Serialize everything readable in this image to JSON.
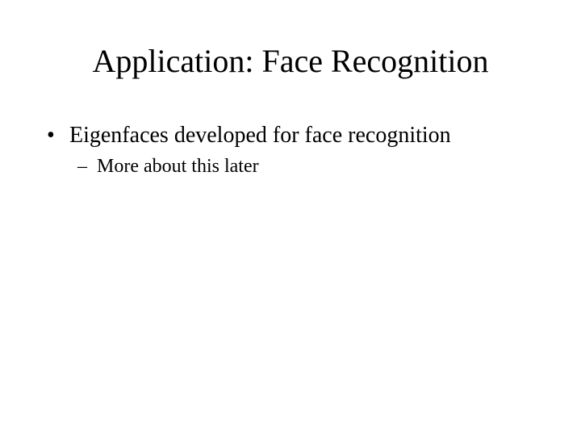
{
  "slide": {
    "title": "Application: Face Recognition",
    "bullets": [
      {
        "marker": "•",
        "text": "Eigenfaces developed for face recognition",
        "sub": {
          "marker": "–",
          "text": "More about this later"
        }
      }
    ]
  }
}
